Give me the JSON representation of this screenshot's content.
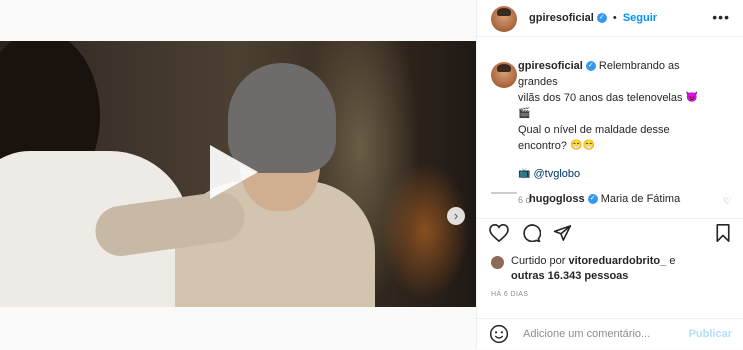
{
  "post": {
    "username": "gpiresoficial",
    "follow_label": "Seguir",
    "more_glyph": "•••",
    "caption_line1": "Relembrando as grandes",
    "caption_line2": "vilãs dos 70 anos das telenovelas",
    "caption_line3": "Qual o nível de maldade desse",
    "caption_line4": "encontro?",
    "mention": "@tvglobo",
    "caption_time": "6 d",
    "comment_user": "hugogloss",
    "comment_text": "Maria de Fátima",
    "liked_prefix": "Curtido por",
    "liked_user": "vitoreduardobrito_",
    "liked_conj": "e",
    "liked_rest": "outras 16.343 pessoas",
    "posted_ago": "HÁ 6 DIAS",
    "comment_placeholder": "Adicione um comentário...",
    "publish_label": "Publicar"
  },
  "icons": {
    "heart": "heart-icon",
    "comment": "comment-icon",
    "share": "share-icon",
    "save": "bookmark-icon",
    "emoji": "emoji-icon",
    "play": "play-icon",
    "next": "chevron-right-icon",
    "user_tag": "user-tag-icon",
    "mute": "mute-icon"
  },
  "colors": {
    "link": "#0095f6",
    "verified": "#3897f0",
    "muted": "#8e8e8e",
    "publish_disabled": "#b2dffc"
  }
}
